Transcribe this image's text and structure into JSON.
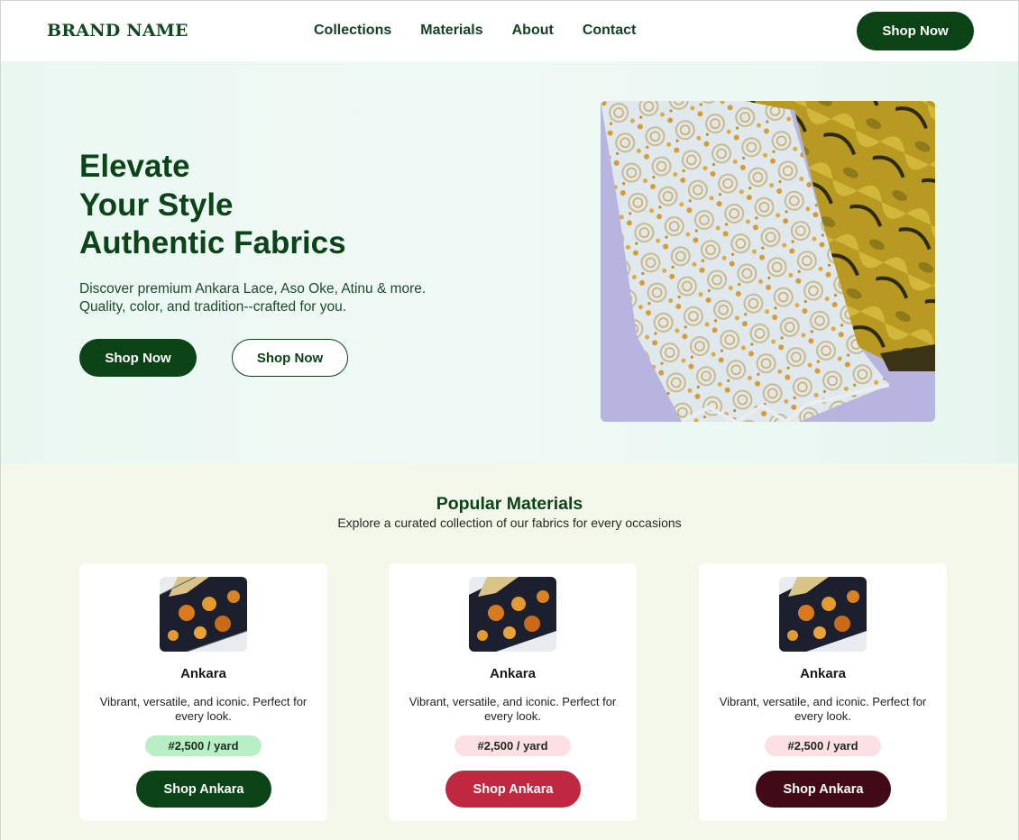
{
  "nav": {
    "brand": "BRAND NAME",
    "links": [
      "Collections",
      "Materials",
      "About",
      "Contact"
    ],
    "cta": "Shop Now"
  },
  "hero": {
    "title_lines": [
      "Elevate",
      "Your Style",
      "Authentic Fabrics"
    ],
    "desc_lines": [
      "Discover premium Ankara Lace, Aso Oke, Atinu & more.",
      "Quality, color, and tradition--crafted for you."
    ],
    "primary_btn": "Shop Now",
    "secondary_btn": "Shop Now"
  },
  "popular": {
    "title": "Popular Materials",
    "subtitle": "Explore a curated collection of our fabrics for every occasions",
    "cards": [
      {
        "name": "Ankara",
        "desc": "Vibrant, versatile, and iconic. Perfect for every look.",
        "price": "#2,500 / yard",
        "button": "Shop Ankara",
        "price_bg": "#b9efc4",
        "button_bg": "#0b4317"
      },
      {
        "name": "Ankara",
        "desc": "Vibrant, versatile, and iconic. Perfect for every look.",
        "price": "#2,500 / yard",
        "button": "Shop Ankara",
        "price_bg": "#fde0e4",
        "button_bg": "#c0283f"
      },
      {
        "name": "Ankara",
        "desc": "Vibrant, versatile, and iconic. Perfect for every look.",
        "price": "#2,500 / yard",
        "button": "Shop Ankara",
        "price_bg": "#fde0e4",
        "button_bg": "#420a17"
      }
    ]
  },
  "colors": {
    "brand_green": "#0b4317",
    "hero_bg": "#eaf7f1",
    "section_bg": "#f3f8ea"
  }
}
